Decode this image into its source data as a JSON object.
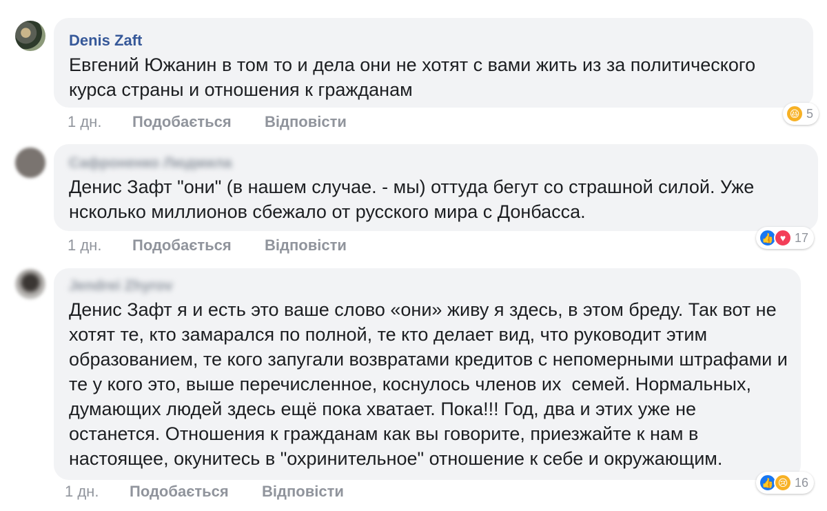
{
  "comments": [
    {
      "author": "Denis Zaft",
      "text": "Евгений Южанин в том то и дела они не хотят с вами жить из за политического курса страны и отношения к гражданам",
      "time": "1 дн.",
      "like_label": "Подобається",
      "reply_label": "Відповісти",
      "reactions": [
        "haha"
      ],
      "reaction_count": "5"
    },
    {
      "author": "Сафроненко Людмила",
      "text": "Денис Зафт \"они\" (в нашем случае. - мы) оттуда бегут со страшной силой. Уже нсколько миллионов сбежало от русского мира с Донбасса.",
      "time": "1 дн.",
      "like_label": "Подобається",
      "reply_label": "Відповісти",
      "reactions": [
        "like",
        "love"
      ],
      "reaction_count": "17"
    },
    {
      "author": "Jendrei Zhyrov",
      "text": "Денис Зафт я и есть это ваше слово «они» живу я здесь, в этом бреду. Так вот не хотят те, кто замарался по полной, те кто делает вид, что руководит этим образованием, те кого запугали возвратами кредитов с непомерными штрафами и те у кого это, выше перечисленное, коснулось членов их  семей. Нормальных, думающих людей здесь ещё пока хватает. Пока!!! Год, два и этих уже не останется. Отношения к гражданам как вы говорите, приезжайте к нам в настоящее, окунитесь в \"охринительное\" отношение к себе и окружающим.",
      "time": "1 дн.",
      "like_label": "Подобається",
      "reply_label": "Відповісти",
      "reactions": [
        "like",
        "sad"
      ],
      "reaction_count": "16"
    }
  ]
}
